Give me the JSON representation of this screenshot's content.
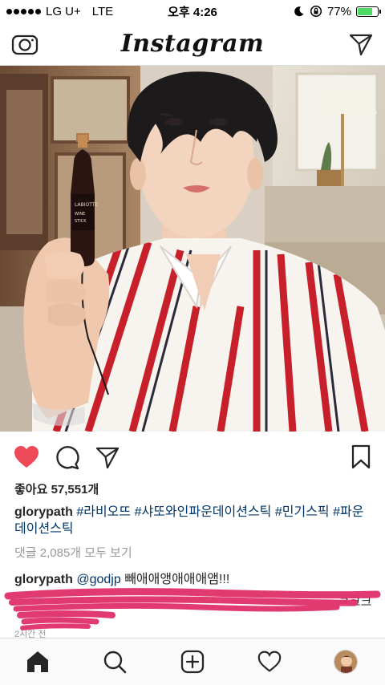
{
  "status_bar": {
    "carrier": "LG U+",
    "network": "LTE",
    "time": "오후 4:26",
    "battery": "77%",
    "battery_level": 0.77
  },
  "header": {
    "logo": "Instagram"
  },
  "post": {
    "likes_text": "좋아요 57,551개",
    "caption_user": "glorypath",
    "caption_tags": [
      "#라비오뜨",
      "#샤또와인파운데이션스틱",
      "#민기스픽",
      "#파운데이션스틱"
    ],
    "view_comments": "댓글 2,085개 모두 보기",
    "comment1_user": "glorypath",
    "comment1_mention": "@godjp",
    "comment1_text": "빼애애앵애애애앰!!!",
    "comment2_end": "ㅋ크크",
    "time": "2시간 전"
  },
  "icons": {
    "camera": "camera-icon",
    "direct": "paper-plane-icon",
    "like": "heart-filled-icon",
    "comment": "speech-bubble-icon",
    "share": "paper-plane-icon",
    "save": "bookmark-icon",
    "home": "home-icon",
    "search": "search-icon",
    "add": "plus-square-icon",
    "activity": "heart-outline-icon"
  },
  "colors": {
    "like_red": "#ed4956",
    "hashtag": "#003569",
    "muted": "#999999",
    "scribble": "#e0306a"
  }
}
